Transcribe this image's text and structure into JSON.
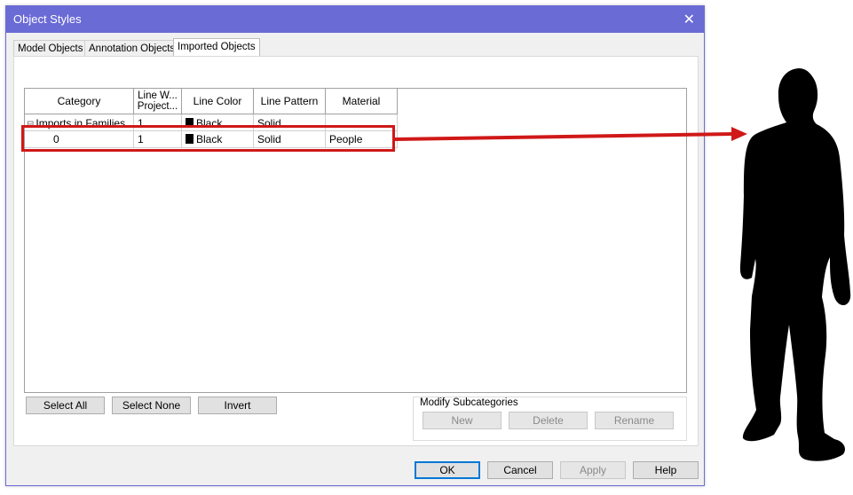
{
  "window": {
    "title": "Object Styles",
    "close_glyph": "✕"
  },
  "tabs": [
    "Model Objects",
    "Annotation Objects",
    "Imported Objects"
  ],
  "active_tab": "Imported Objects",
  "table": {
    "headers": {
      "category": "Category",
      "line_weight_line1": "Line W...",
      "line_weight_line2": "Project...",
      "line_color": "Line Color",
      "line_pattern": "Line Pattern",
      "material": "Material"
    },
    "rows": [
      {
        "category": "Imports in Families",
        "expander": "⊟",
        "line_weight": "1",
        "line_color": "Black",
        "line_pattern": "Solid",
        "material": ""
      },
      {
        "category": "0",
        "line_weight": "1",
        "line_color": "Black",
        "line_pattern": "Solid",
        "material": "People"
      }
    ]
  },
  "selection_buttons": {
    "select_all": "Select All",
    "select_none": "Select None",
    "invert": "Invert"
  },
  "modify_subcategories": {
    "label": "Modify Subcategories",
    "new": "New",
    "delete": "Delete",
    "rename": "Rename"
  },
  "footer_buttons": {
    "ok": "OK",
    "cancel": "Cancel",
    "apply": "Apply",
    "help": "Help"
  },
  "colors": {
    "titlebar": "#6b6bd6",
    "annotation_red": "#d01818",
    "silhouette": "#000000"
  }
}
